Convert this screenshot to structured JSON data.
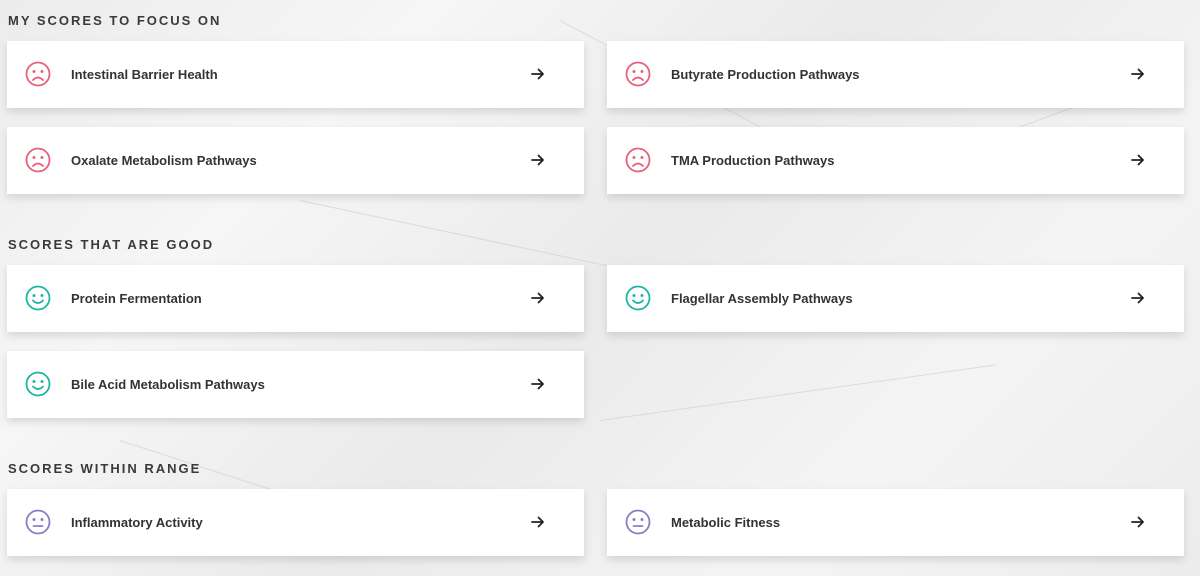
{
  "colors": {
    "focus": "#e8607a",
    "good": "#1fb5a4",
    "range": "#8e7cc3",
    "arrow": "#222222"
  },
  "sections": [
    {
      "heading": "MY SCORES TO FOCUS ON",
      "mood": "sad",
      "items": [
        {
          "label": "Intestinal Barrier Health"
        },
        {
          "label": "Butyrate Production Pathways"
        },
        {
          "label": "Oxalate Metabolism Pathways"
        },
        {
          "label": "TMA Production Pathways"
        }
      ]
    },
    {
      "heading": "SCORES THAT ARE GOOD",
      "mood": "happy",
      "items": [
        {
          "label": "Protein Fermentation"
        },
        {
          "label": "Flagellar Assembly Pathways"
        },
        {
          "label": "Bile Acid Metabolism Pathways"
        }
      ]
    },
    {
      "heading": "SCORES WITHIN RANGE",
      "mood": "neutral",
      "items": [
        {
          "label": "Inflammatory Activity"
        },
        {
          "label": "Metabolic Fitness"
        }
      ]
    }
  ]
}
